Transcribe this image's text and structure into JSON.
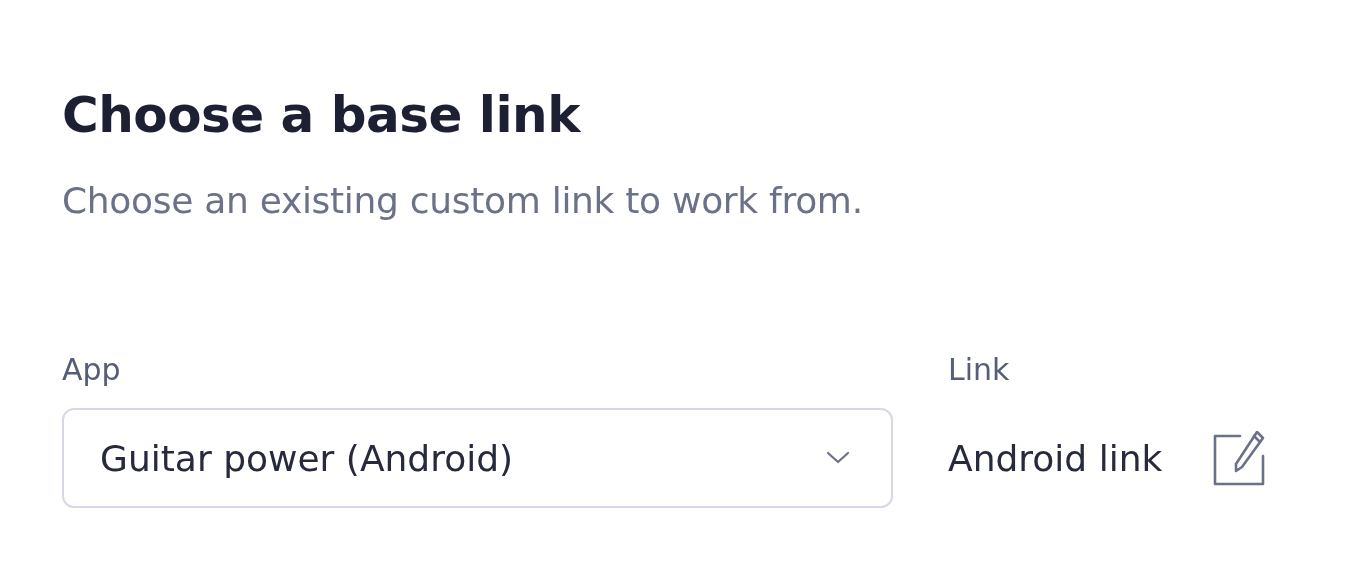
{
  "title": "Choose a base link",
  "subtitle": "Choose an existing custom link to work from.",
  "app": {
    "label": "App",
    "value": "Guitar power (Android)"
  },
  "link": {
    "label": "Link",
    "value": "Android link"
  }
}
